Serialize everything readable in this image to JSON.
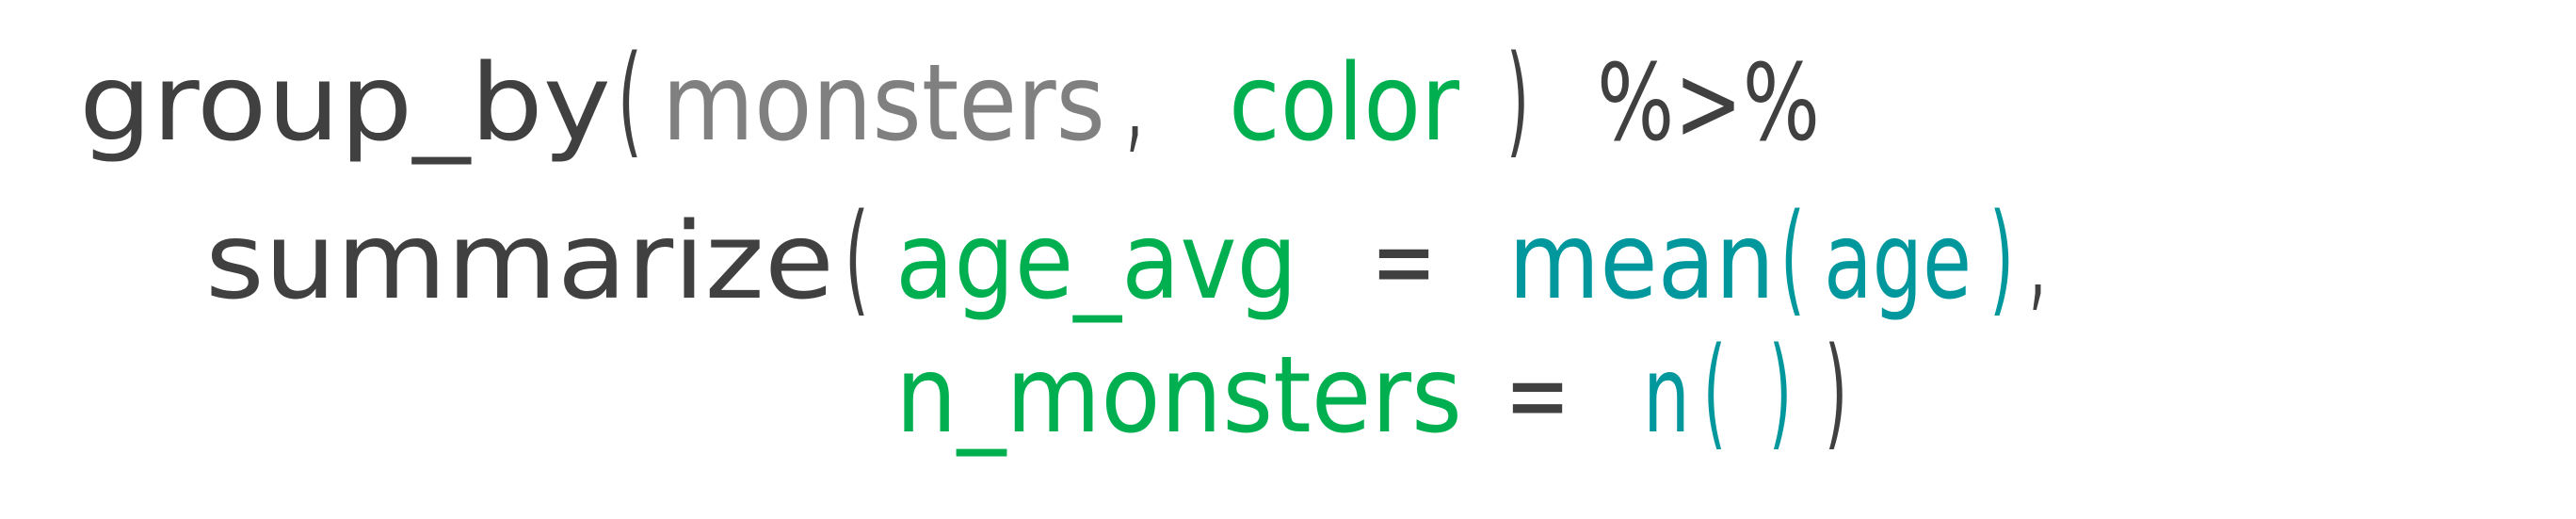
{
  "colors": {
    "function": "#404040",
    "data": "#808080",
    "variable": "#00B050",
    "inner_function": "#00979D",
    "background": "#ffffff"
  },
  "line1": {
    "fn": "group_by",
    "open": "(",
    "arg1": "monsters",
    "comma": ",",
    "arg2": "color",
    "close": ")",
    "pipe": "%>%"
  },
  "line2": {
    "fn": "summarize",
    "open": "(",
    "name": "age_avg",
    "eq": "=",
    "inner_fn": "mean",
    "inner_open": "(",
    "inner_arg": "age",
    "inner_close": ")",
    "comma": ","
  },
  "line3": {
    "name": "n_monsters",
    "eq": "=",
    "inner_fn": "n",
    "inner_open": "(",
    "inner_close": ")",
    "close": ")"
  }
}
